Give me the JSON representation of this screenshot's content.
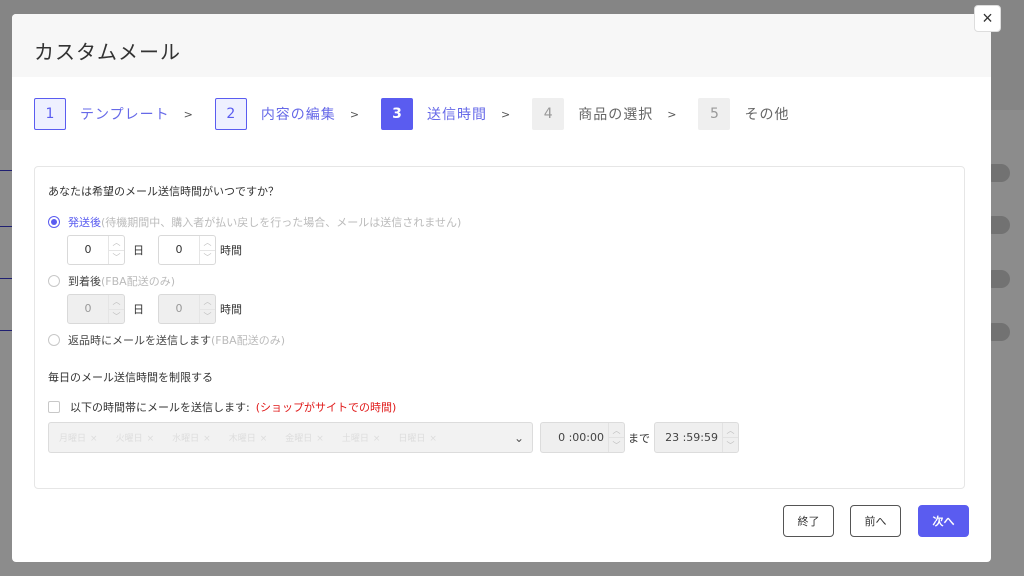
{
  "modal": {
    "title": "カスタムメール",
    "close_label": "×"
  },
  "steps": [
    {
      "num": "1",
      "label": "テンプレート",
      "state": "done"
    },
    {
      "num": "2",
      "label": "内容の編集",
      "state": "done"
    },
    {
      "num": "3",
      "label": "送信時間",
      "state": "active"
    },
    {
      "num": "4",
      "label": "商品の選択",
      "state": "disabled"
    },
    {
      "num": "5",
      "label": "その他",
      "state": "disabled"
    }
  ],
  "step_separator": ">",
  "form": {
    "question": "あなたは希望のメール送信時間がいつですか？",
    "option_after_shipping": {
      "label": "発送後",
      "note": "(待機期間中、購入者が払い戻しを行った場合、メールは送信されません)",
      "days": "0",
      "hours": "0"
    },
    "option_after_arrival": {
      "label": "到着後",
      "note": "(FBA配送のみ)",
      "days": "0",
      "hours": "0"
    },
    "option_on_return": {
      "label": "返品時にメールを送信します",
      "note": "(FBA配送のみ)"
    },
    "unit_day": "日",
    "unit_hour": "時間",
    "limit_title": "毎日のメール送信時間を制限する",
    "limit_checkbox_label": "以下の時間帯にメールを送信します:",
    "limit_checkbox_note": "(ショップがサイトでの時間)",
    "weekdays": [
      "月曜日",
      "火曜日",
      "水曜日",
      "木曜日",
      "金曜日",
      "土曜日",
      "日曜日"
    ],
    "time_from": "0 :00:00",
    "until_label": "まで",
    "time_to": "23 :59:59"
  },
  "footer": {
    "end_label": "終了",
    "prev_label": "前へ",
    "next_label": "次へ"
  },
  "colors": {
    "accent": "#5a5cf0",
    "warning": "#e01b1b"
  }
}
